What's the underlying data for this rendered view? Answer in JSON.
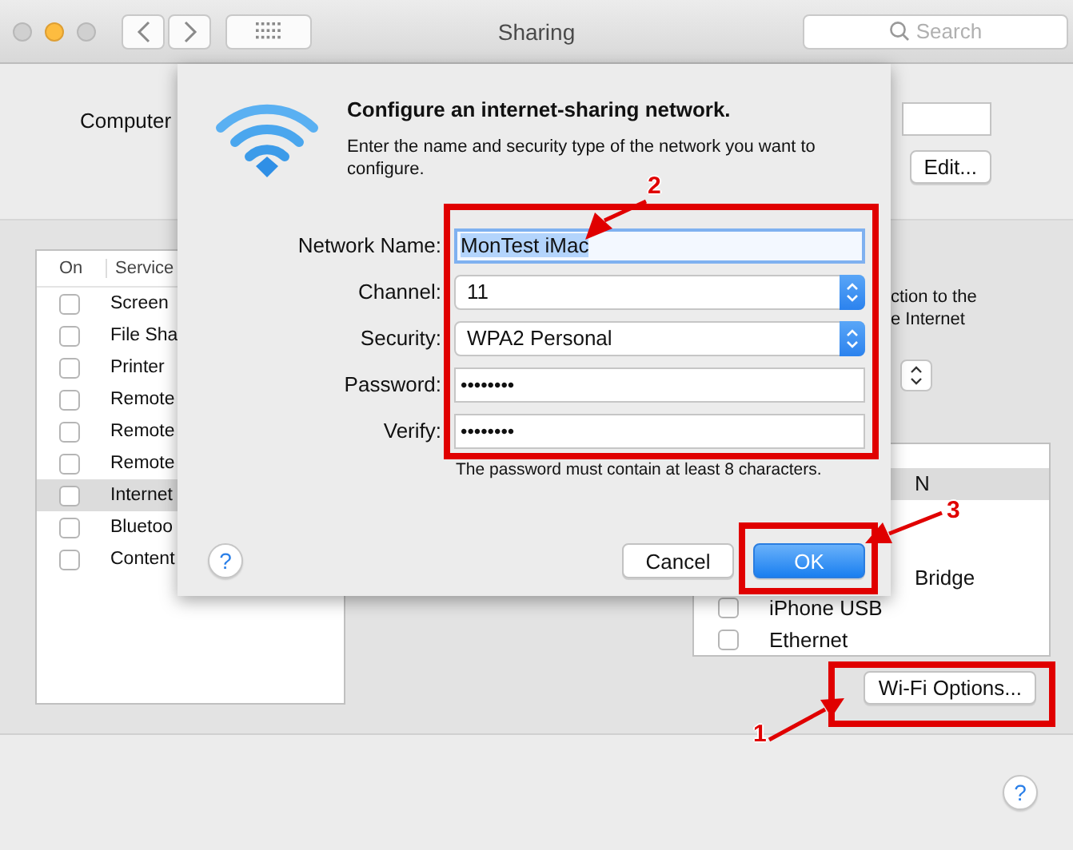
{
  "window": {
    "title": "Sharing"
  },
  "search": {
    "placeholder": "Search"
  },
  "computer_name": {
    "label": "Computer",
    "button": "Edit..."
  },
  "services": {
    "columns": [
      "On",
      "Service"
    ],
    "rows": [
      {
        "name": "Screen",
        "checked": false,
        "selected": false
      },
      {
        "name": "File Sha",
        "checked": false,
        "selected": false
      },
      {
        "name": "Printer",
        "checked": false,
        "selected": false
      },
      {
        "name": "Remote",
        "checked": false,
        "selected": false
      },
      {
        "name": "Remote",
        "checked": false,
        "selected": false
      },
      {
        "name": "Remote",
        "checked": false,
        "selected": false
      },
      {
        "name": "Internet",
        "checked": false,
        "selected": true
      },
      {
        "name": "Bluetoo",
        "checked": false,
        "selected": false
      },
      {
        "name": "Content",
        "checked": false,
        "selected": false
      }
    ]
  },
  "sharing_info": [
    "ction to the",
    "e Internet"
  ],
  "ports": [
    {
      "name": "N",
      "selected": true
    },
    {
      "name": "Bridge",
      "selected": false
    },
    {
      "name": "iPhone USB",
      "checked": false,
      "selected": false
    },
    {
      "name": "Ethernet",
      "checked": false,
      "selected": false
    }
  ],
  "wifi_options_button": "Wi-Fi Options...",
  "sheet": {
    "title": "Configure an internet-sharing network.",
    "description": "Enter the name and security type of the network you want to configure.",
    "fields": [
      {
        "label": "Network Name:",
        "kind": "text",
        "value": "MonTest iMac",
        "focused": true
      },
      {
        "label": "Channel:",
        "kind": "popup",
        "value": "11"
      },
      {
        "label": "Security:",
        "kind": "popup",
        "value": "WPA2 Personal"
      },
      {
        "label": "Password:",
        "kind": "password",
        "value": "••••••••",
        "focused": false
      },
      {
        "label": "Verify:",
        "kind": "password",
        "value": "••••••••",
        "focused": false
      }
    ],
    "hint": "The password must contain at least 8 characters.",
    "help": "?",
    "buttons": [
      {
        "label": "Cancel",
        "default": false
      },
      {
        "label": "OK",
        "default": true
      }
    ]
  },
  "help_button": "?",
  "markers": [
    {
      "number": "1"
    },
    {
      "number": "2"
    },
    {
      "number": "3"
    }
  ]
}
